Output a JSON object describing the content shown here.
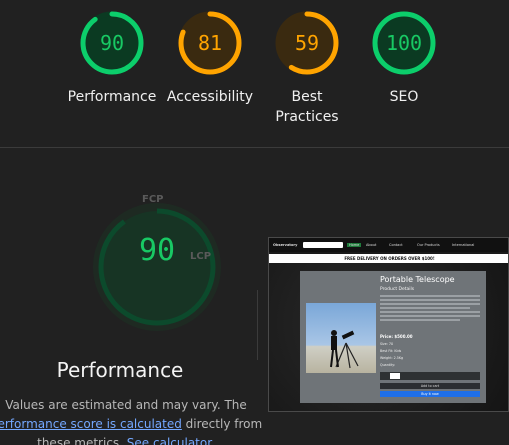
{
  "gauges": [
    {
      "score": "90",
      "label": "Performance",
      "color": "#0cce6b",
      "fraction": 0.9
    },
    {
      "score": "81",
      "label": "Accessibility",
      "color": "#ffa400",
      "fraction": 0.81
    },
    {
      "score": "59",
      "label": "Best Practices",
      "color": "#ffa400",
      "fraction": 0.59
    },
    {
      "score": "100",
      "label": "SEO",
      "color": "#0cce6b",
      "fraction": 1.0
    }
  ],
  "performance": {
    "score": "90",
    "fraction": 0.9,
    "title": "Performance",
    "metric_tags": {
      "fcp": "FCP",
      "lcp": "LCP"
    },
    "desc_prefix": "Values are estimated and may vary. The ",
    "desc_link": "performance score is calculated",
    "desc_middle": " directly from these metrics. ",
    "desc_calc_link": "See calculator."
  },
  "screenshot": {
    "brand": "Observatory",
    "nav_items": [
      "Home",
      "About",
      "Contact",
      "Our Products",
      "International"
    ],
    "banner": "FREE DELIVERY ON ORDERS OVER $100!",
    "product_title": "Portable Telescope",
    "product_subtitle": "Product Details",
    "price": "Price: $500.00",
    "meta": [
      "Size: 70",
      "Best Fit: Kids",
      "Weight: 2.5Kg",
      "Quantity:"
    ],
    "add_to_cart": "Add to cart",
    "buy_now": "Buy it now"
  },
  "colors": {
    "good": "#0cce6b",
    "average": "#ffa400",
    "background": "#212121"
  }
}
